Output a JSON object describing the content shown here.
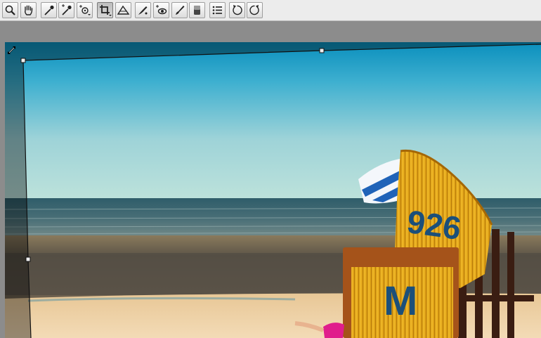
{
  "toolbar": {
    "tools": [
      {
        "icon": "zoom-icon",
        "active": false
      },
      {
        "icon": "hand-icon",
        "active": false
      },
      {
        "icon": "white-balance-eyedropper-icon",
        "active": false
      },
      {
        "icon": "color-sampler-icon",
        "active": false
      },
      {
        "icon": "targeted-adjustment-icon",
        "active": false
      },
      {
        "icon": "crop-icon",
        "active": true
      },
      {
        "icon": "straighten-icon",
        "active": false
      },
      {
        "icon": "spot-removal-icon",
        "active": false
      },
      {
        "icon": "red-eye-removal-icon",
        "active": false
      },
      {
        "icon": "adjustment-brush-icon",
        "active": false
      },
      {
        "icon": "graduated-filter-icon",
        "active": false
      },
      {
        "icon": "preferences-list-icon",
        "active": false
      },
      {
        "icon": "rotate-left-icon",
        "active": false
      },
      {
        "icon": "rotate-right-icon",
        "active": false
      }
    ]
  },
  "photo": {
    "basket_text_top": "926",
    "basket_text_front": "M"
  }
}
